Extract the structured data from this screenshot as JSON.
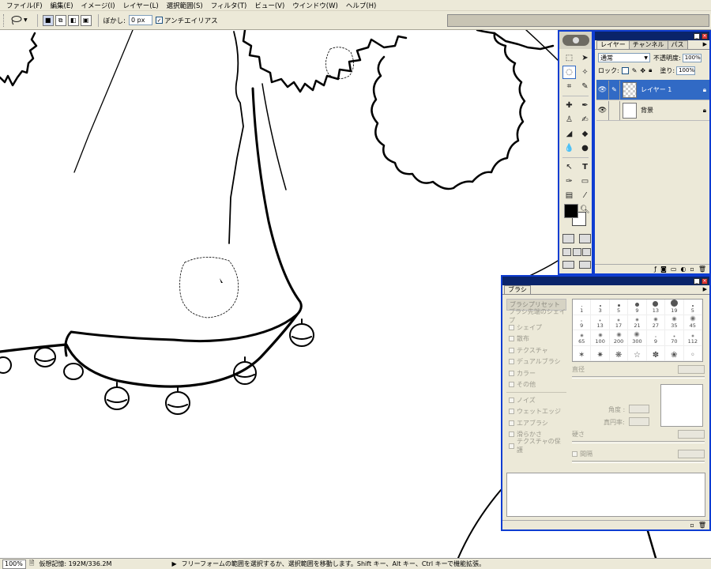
{
  "menu": [
    "ファイル(F)",
    "編集(E)",
    "イメージ(I)",
    "レイヤー(L)",
    "選択範囲(S)",
    "フィルタ(T)",
    "ビュー(V)",
    "ウインドウ(W)",
    "ヘルプ(H)"
  ],
  "options": {
    "tool_icon": "lasso-icon",
    "feather_label": "ぼかし:",
    "feather_value": "0 px",
    "antialias_label": "アンチエイリアス",
    "antialias_checked": true
  },
  "layers": {
    "tabs": [
      "レイヤー",
      "チャンネル",
      "パス"
    ],
    "blend_mode": "通常",
    "opacity_label": "不透明度:",
    "opacity": "100%",
    "lock_label": "ロック:",
    "fill_label": "塗り:",
    "fill": "100%",
    "items": [
      {
        "name": "レイヤー 1",
        "selected": true
      },
      {
        "name": "背景",
        "selected": false
      }
    ]
  },
  "brushes": {
    "tab": "ブラシ",
    "sections": [
      "ブラシプリセット",
      "ブラシ先端のシェイプ",
      "シェイプ",
      "散布",
      "テクスチャ",
      "デュアルブラシ",
      "カラー",
      "その他",
      "ノイズ",
      "ウェットエッジ",
      "エアブラシ",
      "滑らかさ",
      "テクスチャの保護"
    ],
    "presets": [
      "1",
      "3",
      "5",
      "9",
      "13",
      "19",
      "5",
      "9",
      "13",
      "17",
      "21",
      "27",
      "35",
      "45",
      "65",
      "100",
      "200",
      "300",
      "9",
      "70",
      "112",
      "",
      "",
      "",
      "",
      "",
      "",
      ""
    ],
    "diameter_label": "直径",
    "angle_label": "角度 :",
    "roundness_label": "真円率:",
    "hardness_label": "硬さ",
    "spacing_label": "間隔"
  },
  "status": {
    "zoom": "100%",
    "memory": "仮想記憶: 192M/336.2M",
    "hint": "フリーフォームの範囲を選択するか、選択範囲を移動します。Shift キー、Alt キー、Ctrl キーで機能拡張。"
  },
  "colors": {
    "accent": "#0f3dd1",
    "chrome": "#ece9d8",
    "selection": "#316ac5"
  }
}
